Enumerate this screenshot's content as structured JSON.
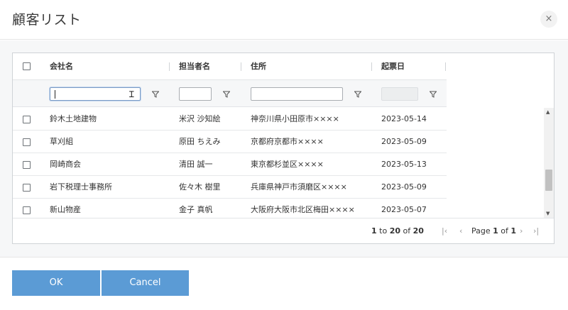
{
  "dialog": {
    "title": "顧客リスト",
    "close_symbol": "×"
  },
  "grid": {
    "columns": [
      {
        "label": "会社名"
      },
      {
        "label": "担当者名"
      },
      {
        "label": "住所"
      },
      {
        "label": "起票日"
      }
    ],
    "filters": {
      "company_value": "",
      "contact_value": "",
      "address_value": "",
      "date_value": ""
    },
    "rows": [
      {
        "company": "鈴木土地建物",
        "contact": "米沢 沙知絵",
        "address": "神奈川県小田原市××××",
        "date": "2023-05-14"
      },
      {
        "company": "草刈組",
        "contact": "原田 ちえみ",
        "address": "京都府京都市××××",
        "date": "2023-05-09"
      },
      {
        "company": "岡崎商会",
        "contact": "清田 誠一",
        "address": "東京都杉並区××××",
        "date": "2023-05-13"
      },
      {
        "company": "岩下税理士事務所",
        "contact": "佐々木 樹里",
        "address": "兵庫県神戸市須磨区××××",
        "date": "2023-05-09"
      },
      {
        "company": "新山物産",
        "contact": "金子 真帆",
        "address": "大阪府大阪市北区梅田××××",
        "date": "2023-05-07"
      }
    ]
  },
  "pager": {
    "range_start": "1",
    "to_word": "to",
    "range_end": "20",
    "of_word": "of",
    "total": "20",
    "page_word": "Page",
    "current_page": "1",
    "page_of_word": "of",
    "total_pages": "1",
    "first_symbol": "|‹",
    "prev_symbol": "‹",
    "next_symbol": "›",
    "last_symbol": "›|"
  },
  "footer": {
    "ok_label": "OK",
    "cancel_label": "Cancel"
  },
  "colors": {
    "button": "#5b9bd5",
    "grid_border": "#cfd3d7"
  },
  "icons": [
    "close-icon",
    "filter-icon",
    "scroll-up-icon",
    "scroll-down-icon",
    "first-page-icon",
    "prev-page-icon",
    "next-page-icon",
    "last-page-icon",
    "text-cursor-icon"
  ]
}
